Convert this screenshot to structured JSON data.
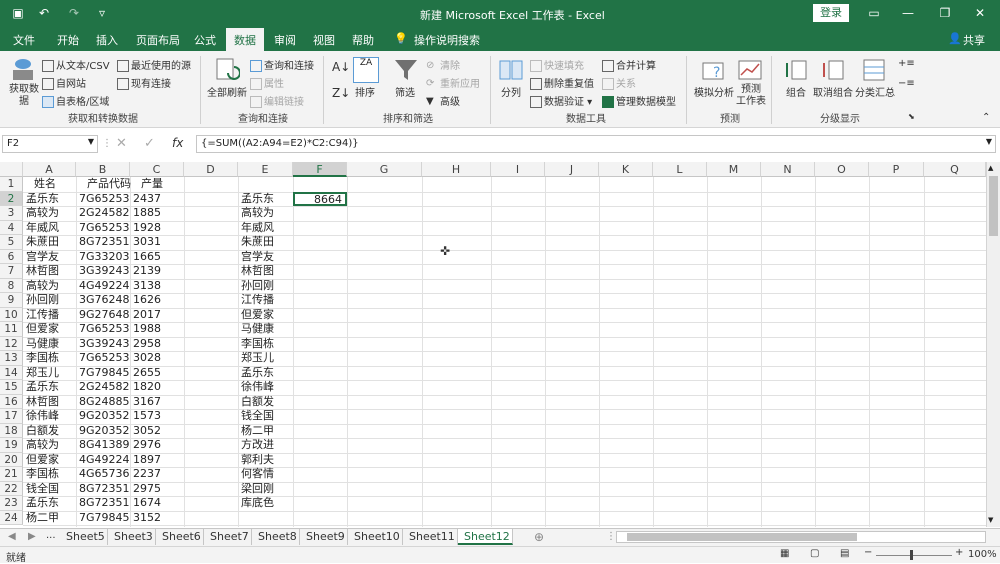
{
  "window": {
    "title": "新建 Microsoft Excel 工作表 - Excel",
    "login": "登录",
    "share": "共享"
  },
  "menu": [
    "文件",
    "开始",
    "插入",
    "页面布局",
    "公式",
    "数据",
    "审阅",
    "视图",
    "帮助"
  ],
  "tellme": "操作说明搜索",
  "ribbon": {
    "get_data": "获取数\n据",
    "from_text": "从文本/CSV",
    "from_web": "自网站",
    "from_table": "自表格/区域",
    "recent_sources": "最近使用的源",
    "existing_conn": "现有连接",
    "group_get": "获取和转换数据",
    "refresh_all": "全部刷新",
    "queries_conn": "查询和连接",
    "properties": "属性",
    "edit_links": "编辑链接",
    "group_queries": "查询和连接",
    "sort": "排序",
    "filter": "筛选",
    "clear": "清除",
    "reapply": "重新应用",
    "advanced": "高级",
    "group_sort": "排序和筛选",
    "text_to_col": "分列",
    "flash_fill": "快速填充",
    "remove_dup": "删除重复值",
    "validation": "数据验证",
    "consolidate": "合并计算",
    "relationships": "关系",
    "data_model": "管理数据模型",
    "group_tools": "数据工具",
    "what_if": "模拟分析",
    "forecast_sheet": "预测\n工作表",
    "group_forecast": "预测",
    "group_btn": "组合",
    "ungroup": "取消组合",
    "subtotal": "分类汇总",
    "group_outline": "分级显示"
  },
  "formula_bar": {
    "namebox": "F2",
    "formula": "{=SUM((A2:A94=E2)*C2:C94)}"
  },
  "columns": [
    "A",
    "B",
    "C",
    "D",
    "E",
    "F",
    "G",
    "H",
    "I",
    "J",
    "K",
    "L",
    "M",
    "N",
    "O",
    "P",
    "Q"
  ],
  "rows": [
    [
      "1",
      "姓名",
      "产品代码",
      "产量",
      "",
      "",
      ""
    ],
    [
      "2",
      "孟乐东",
      "7G65253",
      "2437",
      "",
      "孟乐东",
      "8664"
    ],
    [
      "3",
      "高较为",
      "2G24582",
      "1885",
      "",
      "高较为",
      ""
    ],
    [
      "4",
      "年威风",
      "7G65253",
      "1928",
      "",
      "年威风",
      ""
    ],
    [
      "5",
      "朱蔗田",
      "8G72351",
      "3031",
      "",
      "朱蔗田",
      ""
    ],
    [
      "6",
      "宫学友",
      "7G33203",
      "1665",
      "",
      "宫学友",
      ""
    ],
    [
      "7",
      "林哲图",
      "3G39243",
      "2139",
      "",
      "林哲图",
      ""
    ],
    [
      "8",
      "高较为",
      "4G49224",
      "3138",
      "",
      "孙回刚",
      ""
    ],
    [
      "9",
      "孙回刚",
      "3G76248",
      "1626",
      "",
      "江传播",
      ""
    ],
    [
      "10",
      "江传播",
      "9G27648",
      "2017",
      "",
      "但爱家",
      ""
    ],
    [
      "11",
      "但爱家",
      "7G65253",
      "1988",
      "",
      "马健康",
      ""
    ],
    [
      "12",
      "马健康",
      "3G39243",
      "2958",
      "",
      "李国栋",
      ""
    ],
    [
      "13",
      "李国栋",
      "7G65253",
      "3028",
      "",
      "郑玉儿",
      ""
    ],
    [
      "14",
      "郑玉儿",
      "7G79845",
      "2655",
      "",
      "孟乐东",
      ""
    ],
    [
      "15",
      "孟乐东",
      "2G24582",
      "1820",
      "",
      "徐伟峰",
      ""
    ],
    [
      "16",
      "林哲图",
      "8G24885",
      "3167",
      "",
      "白额发",
      ""
    ],
    [
      "17",
      "徐伟峰",
      "9G20352",
      "1573",
      "",
      "钱全国",
      ""
    ],
    [
      "18",
      "白额发",
      "9G20352",
      "3052",
      "",
      "杨二甲",
      ""
    ],
    [
      "19",
      "高较为",
      "8G41389",
      "2976",
      "",
      "方改进",
      ""
    ],
    [
      "20",
      "但爱家",
      "4G49224",
      "1897",
      "",
      "郭利夫",
      ""
    ],
    [
      "21",
      "李国栋",
      "4G65736",
      "2237",
      "",
      "何客情",
      ""
    ],
    [
      "22",
      "钱全国",
      "8G72351",
      "2975",
      "",
      "梁回刚",
      ""
    ],
    [
      "23",
      "孟乐东",
      "8G72351",
      "1674",
      "",
      "库底色",
      ""
    ],
    [
      "24",
      "杨二甲",
      "7G79845",
      "3152",
      "",
      "",
      ""
    ]
  ],
  "sheets": [
    "Sheet5",
    "Sheet3",
    "Sheet6",
    "Sheet7",
    "Sheet8",
    "Sheet9",
    "Sheet10",
    "Sheet11",
    "Sheet12"
  ],
  "active_sheet": "Sheet12",
  "status": {
    "ready": "就绪",
    "zoom": "100%"
  },
  "colors": {
    "excel_green": "#217346"
  }
}
